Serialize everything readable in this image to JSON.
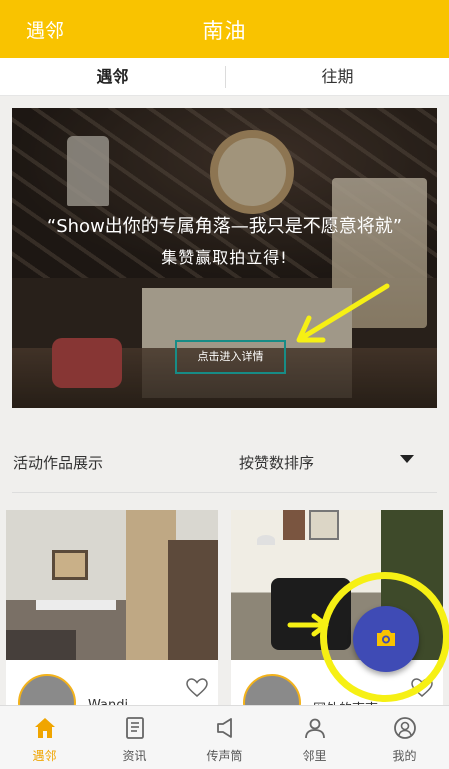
{
  "header": {
    "left_label": "遇邻",
    "title": "南油"
  },
  "tabs": [
    {
      "label": "遇邻"
    },
    {
      "label": "往期"
    }
  ],
  "banner": {
    "headline": "“Show出你的专属角落—我只是不愿意将就”",
    "subline": "集赞赢取拍立得!",
    "button_label": "点击进入详情"
  },
  "section": {
    "title": "活动作品展示",
    "sort_label": "按赞数排序"
  },
  "cards": [
    {
      "username": "Wandi..."
    },
    {
      "username": "网外的南南"
    }
  ],
  "bottom_nav": [
    {
      "label": "遇邻",
      "icon": "home-icon"
    },
    {
      "label": "资讯",
      "icon": "news-icon"
    },
    {
      "label": "传声筒",
      "icon": "megaphone-icon"
    },
    {
      "label": "邻里",
      "icon": "neighbor-icon"
    },
    {
      "label": "我的",
      "icon": "profile-icon"
    }
  ],
  "colors": {
    "accent": "#f9c300",
    "fab": "#3f4bb5",
    "highlight_ring": "#f6f014",
    "button_border": "#178c86",
    "active_tab": "#f0a500"
  }
}
